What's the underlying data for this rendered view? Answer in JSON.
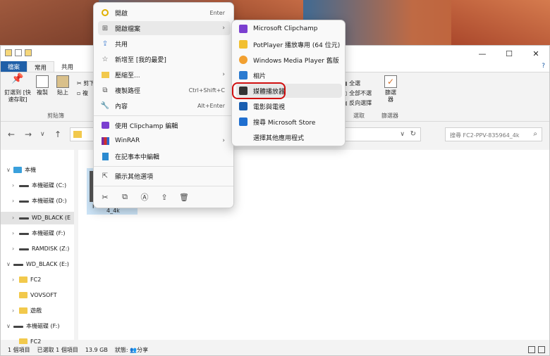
{
  "explorer": {
    "tabs": [
      "檔案",
      "常用",
      "共用"
    ],
    "ribbon": {
      "pin_label": "釘選到 [快速存取]",
      "copy_label": "複製",
      "paste_label": "貼上",
      "clipboard_group": "剪貼簿",
      "cut_label": "剪下",
      "copy_small": "複",
      "select_all": "全選",
      "select_none": "全部不選",
      "invert_select": "反向選擇",
      "select_group": "選取",
      "filter_label": "篩選器",
      "filter_group": "篩選器",
      "filter_btn": "篩選\n器"
    },
    "search_placeholder": "搜尋 FC2-PPV-835964_4k",
    "tree": [
      {
        "label": "本機",
        "icon": "pc"
      },
      {
        "label": "本機磁碟 (C:)",
        "icon": "drive"
      },
      {
        "label": "本機磁碟 (D:)",
        "icon": "drive"
      },
      {
        "label": "WD_BLACK (E",
        "icon": "drive"
      },
      {
        "label": "本機磁碟 (F:)",
        "icon": "drive"
      },
      {
        "label": "RAMDISK (Z:)",
        "icon": "drive"
      },
      {
        "label": "WD_BLACK (E:)",
        "icon": "drive"
      },
      {
        "label": "FC2",
        "icon": "folder"
      },
      {
        "label": "VOVSOFT",
        "icon": "folder"
      },
      {
        "label": "遊戲",
        "icon": "folder"
      },
      {
        "label": "本機磁碟 (F:)",
        "icon": "drive"
      },
      {
        "label": "FC2",
        "icon": "folder"
      }
    ],
    "file_label": "4_4k",
    "file_letter": "F",
    "status": {
      "count": "1 個項目",
      "selected": "已選取 1 個項目",
      "size": "13.9 GB",
      "state_label": "狀態:",
      "state_value": "分享"
    }
  },
  "context_menu": {
    "items": [
      {
        "label": "開啟",
        "shortcut": "Enter"
      },
      {
        "label": "開啟檔案",
        "shortcut": ""
      },
      {
        "label": "共用",
        "shortcut": ""
      },
      {
        "label": "新增至 [我的最愛]",
        "shortcut": ""
      },
      {
        "label": "壓縮至...",
        "shortcut": ""
      },
      {
        "label": "複製路徑",
        "shortcut": "Ctrl+Shift+C"
      },
      {
        "label": "內容",
        "shortcut": "Alt+Enter"
      },
      {
        "label": "使用 Clipchamp 編輯",
        "shortcut": ""
      },
      {
        "label": "WinRAR",
        "shortcut": ""
      },
      {
        "label": "在記事本中編輯",
        "shortcut": ""
      },
      {
        "label": "顯示其他選項",
        "shortcut": ""
      }
    ]
  },
  "open_with_menu": {
    "items": [
      {
        "label": "Microsoft Clipchamp"
      },
      {
        "label": "PotPlayer 播放專用 (64 位元)"
      },
      {
        "label": "Windows Media Player 舊版"
      },
      {
        "label": "相片"
      },
      {
        "label": "媒體播放器"
      },
      {
        "label": "電影與電視"
      },
      {
        "label": "搜尋 Microsoft Store"
      },
      {
        "label": "選擇其他應用程式"
      }
    ]
  },
  "colors": {
    "accent": "#1f5fa8",
    "highlight_box": "#d01010"
  }
}
